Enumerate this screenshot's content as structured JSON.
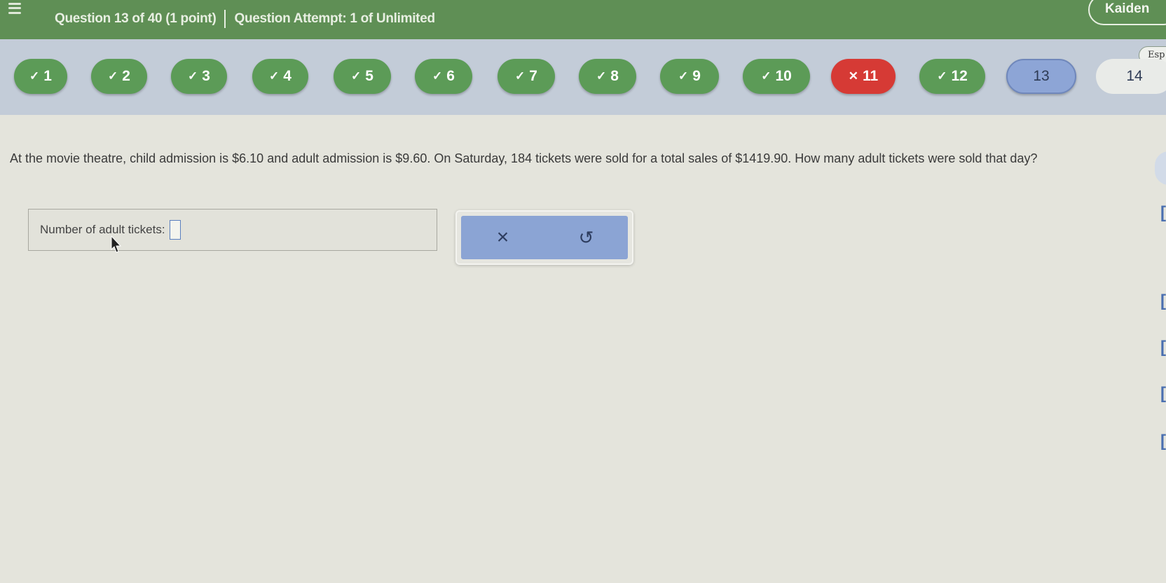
{
  "header": {
    "question_label": "Question 13 of 40 (1 point)",
    "attempt_label": "Question Attempt: 1 of Unlimited",
    "user_name": "Kaiden"
  },
  "question_nav": [
    {
      "label": "1",
      "status": "correct"
    },
    {
      "label": "2",
      "status": "correct"
    },
    {
      "label": "3",
      "status": "correct"
    },
    {
      "label": "4",
      "status": "correct"
    },
    {
      "label": "5",
      "status": "correct"
    },
    {
      "label": "6",
      "status": "correct"
    },
    {
      "label": "7",
      "status": "correct"
    },
    {
      "label": "8",
      "status": "correct"
    },
    {
      "label": "9",
      "status": "correct"
    },
    {
      "label": "10",
      "status": "correct"
    },
    {
      "label": "11",
      "status": "incorrect"
    },
    {
      "label": "12",
      "status": "correct"
    },
    {
      "label": "13",
      "status": "current"
    },
    {
      "label": "14",
      "status": "unanswered"
    }
  ],
  "language_toggle": "Esp",
  "question": {
    "text": "At the movie theatre, child admission is $6.10 and adult admission is $9.60. On Saturday, 184 tickets were sold for a total sales of $1419.90. How many adult tickets were sold that day?"
  },
  "answer": {
    "label": "Number of adult tickets:",
    "value": ""
  },
  "tools": {
    "clear_icon": "×",
    "undo_icon": "↺"
  },
  "colors": {
    "header_green": "#5f8f55",
    "correct_green": "#5c9b57",
    "incorrect_red": "#d63a35",
    "current_blue": "#8da5d6"
  }
}
